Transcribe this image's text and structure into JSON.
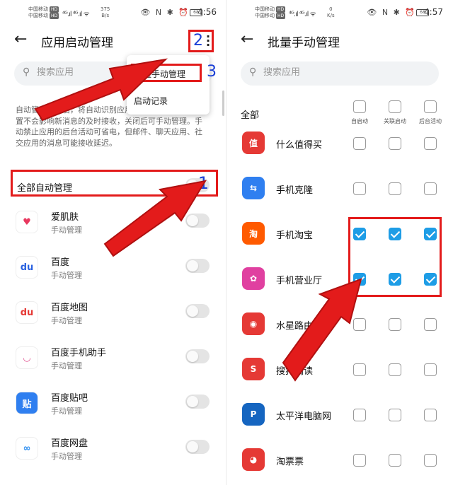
{
  "left": {
    "status": {
      "carrier1": "中国移动",
      "carrier2": "中国移动",
      "hd": "HD",
      "speed_value": "375",
      "speed_unit": "B/s",
      "battery": "68",
      "time": "4:56"
    },
    "title": "应用启动管理",
    "annotation_2": "2",
    "search_placeholder": "搜索应用",
    "menu": {
      "batch": "批量手动管理",
      "annotation_3": "3",
      "records": "启动记录"
    },
    "description": "自动管理应用后，将自动识别应用不必要的启动。此配置不会影响新消息的及时接收，关闭后可手动管理。手动禁止应用的后台活动可省电，但邮件、聊天应用、社交应用的消息可能接收延迟。",
    "all_auto": "全部自动管理",
    "annotation_1": "1",
    "apps": [
      {
        "name": "爱肌肤",
        "mode": "手动管理",
        "color": "#ffffff",
        "glyph": "♥",
        "fg": "#e8385f"
      },
      {
        "name": "百度",
        "mode": "手动管理",
        "color": "#ffffff",
        "glyph": "du",
        "fg": "#2a62e0"
      },
      {
        "name": "百度地图",
        "mode": "手动管理",
        "color": "#ffffff",
        "glyph": "du",
        "fg": "#e53935"
      },
      {
        "name": "百度手机助手",
        "mode": "手动管理",
        "color": "#ffffff",
        "glyph": "◡",
        "fg": "#e04a8a"
      },
      {
        "name": "百度贴吧",
        "mode": "手动管理",
        "color": "#2f7ff0",
        "glyph": "贴",
        "fg": "#ffffff"
      },
      {
        "name": "百度网盘",
        "mode": "手动管理",
        "color": "#ffffff",
        "glyph": "∞",
        "fg": "#2a8df0"
      }
    ]
  },
  "right": {
    "status": {
      "carrier1": "中国移动",
      "carrier2": "中国移动",
      "hd": "HD",
      "speed_value": "0",
      "speed_unit": "K/s",
      "battery": "68",
      "time": "4:57"
    },
    "title": "批量手动管理",
    "search_placeholder": "搜索应用",
    "all_label": "全部",
    "columns": [
      "自启动",
      "关联启动",
      "后台活动"
    ],
    "apps": [
      {
        "name": "什么值得买",
        "color": "#e53935",
        "glyph": "值",
        "checked": [
          false,
          false,
          false
        ]
      },
      {
        "name": "手机克隆",
        "color": "#2f7ff0",
        "glyph": "⇆",
        "checked": [
          false,
          false,
          false
        ]
      },
      {
        "name": "手机淘宝",
        "color": "#ff5a00",
        "glyph": "淘",
        "checked": [
          true,
          true,
          true
        ]
      },
      {
        "name": "手机营业厅",
        "color": "#e040a0",
        "glyph": "✿",
        "checked": [
          true,
          true,
          true
        ]
      },
      {
        "name": "水星路由",
        "color": "#e53935",
        "glyph": "◉",
        "checked": [
          false,
          false,
          false
        ]
      },
      {
        "name": "搜狗阅读",
        "color": "#e53935",
        "glyph": "S",
        "checked": [
          false,
          false,
          false
        ]
      },
      {
        "name": "太平洋电脑网",
        "color": "#1565c0",
        "glyph": "P",
        "checked": [
          false,
          false,
          false
        ]
      },
      {
        "name": "淘票票",
        "color": "#e53935",
        "glyph": "◕",
        "checked": [
          false,
          false,
          false
        ]
      }
    ]
  },
  "colors": {
    "annotation_red": "#e31b1b",
    "annotation_blue": "#1a3fd6",
    "check_blue": "#1e9de6"
  }
}
